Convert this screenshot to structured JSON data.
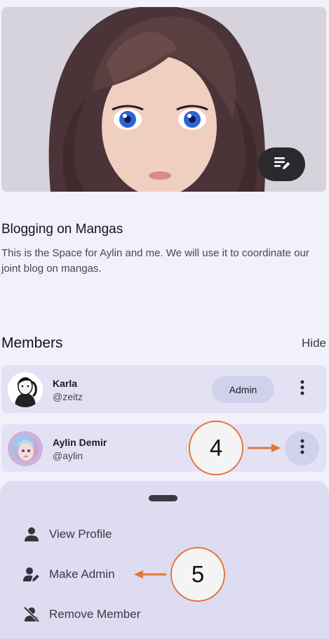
{
  "space": {
    "title": "Blogging on Mangas",
    "description": "This is the Space for Aylin and me. We will use it to coordinate our joint blog on mangas."
  },
  "members": {
    "heading": "Members",
    "hide_label": "Hide",
    "list": [
      {
        "name": "Karla",
        "handle": "@zeitz",
        "role_badge": "Admin"
      },
      {
        "name": "Aylin Demir",
        "handle": "@aylin"
      }
    ]
  },
  "sheet_menu": [
    {
      "label": "View Profile",
      "icon": "person-icon"
    },
    {
      "label": "Make Admin",
      "icon": "person-edit-icon"
    },
    {
      "label": "Remove Member",
      "icon": "person-off-icon"
    }
  ],
  "annotations": {
    "step_4": "4",
    "step_5": "5"
  },
  "colors": {
    "accent_orange": "#e07838",
    "card_bg": "#e3e2f4",
    "sheet_bg": "#dddcf1"
  }
}
